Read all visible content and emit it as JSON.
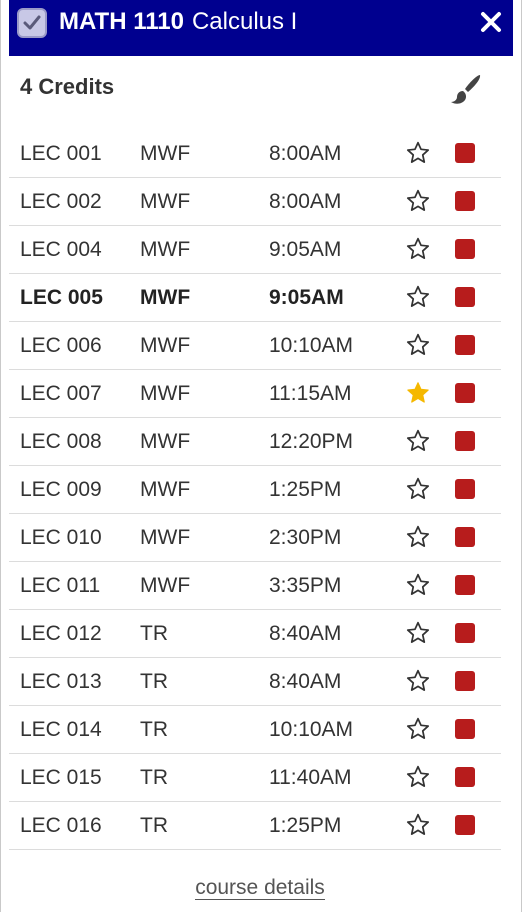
{
  "header": {
    "course_code": "MATH 1110",
    "course_name": "Calculus I",
    "checkbox_checked": true,
    "close_icon": "close-icon",
    "background_color": "#00008f"
  },
  "summary": {
    "credits_label": "4 Credits",
    "paint_icon": "paintbrush-icon"
  },
  "sections": [
    {
      "section": "LEC 001",
      "days": "MWF",
      "time": "8:00AM",
      "starred": false,
      "selected": false,
      "color": "#b71c1c"
    },
    {
      "section": "LEC 002",
      "days": "MWF",
      "time": "8:00AM",
      "starred": false,
      "selected": false,
      "color": "#b71c1c"
    },
    {
      "section": "LEC 004",
      "days": "MWF",
      "time": "9:05AM",
      "starred": false,
      "selected": false,
      "color": "#b71c1c"
    },
    {
      "section": "LEC 005",
      "days": "MWF",
      "time": "9:05AM",
      "starred": false,
      "selected": true,
      "color": "#b71c1c"
    },
    {
      "section": "LEC 006",
      "days": "MWF",
      "time": "10:10AM",
      "starred": false,
      "selected": false,
      "color": "#b71c1c"
    },
    {
      "section": "LEC 007",
      "days": "MWF",
      "time": "11:15AM",
      "starred": true,
      "selected": false,
      "color": "#b71c1c"
    },
    {
      "section": "LEC 008",
      "days": "MWF",
      "time": "12:20PM",
      "starred": false,
      "selected": false,
      "color": "#b71c1c"
    },
    {
      "section": "LEC 009",
      "days": "MWF",
      "time": "1:25PM",
      "starred": false,
      "selected": false,
      "color": "#b71c1c"
    },
    {
      "section": "LEC 010",
      "days": "MWF",
      "time": "2:30PM",
      "starred": false,
      "selected": false,
      "color": "#b71c1c"
    },
    {
      "section": "LEC 011",
      "days": "MWF",
      "time": "3:35PM",
      "starred": false,
      "selected": false,
      "color": "#b71c1c"
    },
    {
      "section": "LEC 012",
      "days": "TR",
      "time": "8:40AM",
      "starred": false,
      "selected": false,
      "color": "#b71c1c"
    },
    {
      "section": "LEC 013",
      "days": "TR",
      "time": "8:40AM",
      "starred": false,
      "selected": false,
      "color": "#b71c1c"
    },
    {
      "section": "LEC 014",
      "days": "TR",
      "time": "10:10AM",
      "starred": false,
      "selected": false,
      "color": "#b71c1c"
    },
    {
      "section": "LEC 015",
      "days": "TR",
      "time": "11:40AM",
      "starred": false,
      "selected": false,
      "color": "#b71c1c"
    },
    {
      "section": "LEC 016",
      "days": "TR",
      "time": "1:25PM",
      "starred": false,
      "selected": false,
      "color": "#b71c1c"
    }
  ],
  "footer": {
    "details_link": "course details"
  },
  "colors": {
    "star_filled": "#f5b800",
    "star_outline": "#333333"
  }
}
